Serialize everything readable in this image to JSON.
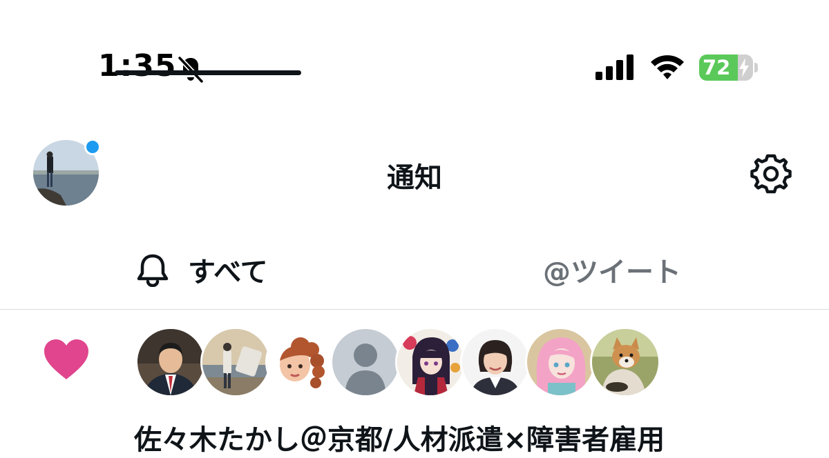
{
  "status_bar": {
    "time": "1:35",
    "battery_percent": "72",
    "battery_level": 0.72,
    "icons": [
      "bell-slash-icon",
      "cellular-signal-icon",
      "wifi-icon",
      "battery-charging-icon"
    ]
  },
  "header": {
    "title": "通知",
    "icons": [
      "profile-avatar",
      "settings-gear-icon"
    ]
  },
  "tabs": {
    "all_label": "すべて",
    "tweets_label": "@ツイート",
    "selected": "すべて"
  },
  "notification": {
    "icon": "heart-icon",
    "text": "佐々木たかし＠京都/人材派遣×障害者雇用"
  },
  "colors": {
    "heart": "#e0458d",
    "accent_blue": "#1d9bf0",
    "battery_green": "#5bc95a",
    "inactive_tab": "#6b7177"
  }
}
